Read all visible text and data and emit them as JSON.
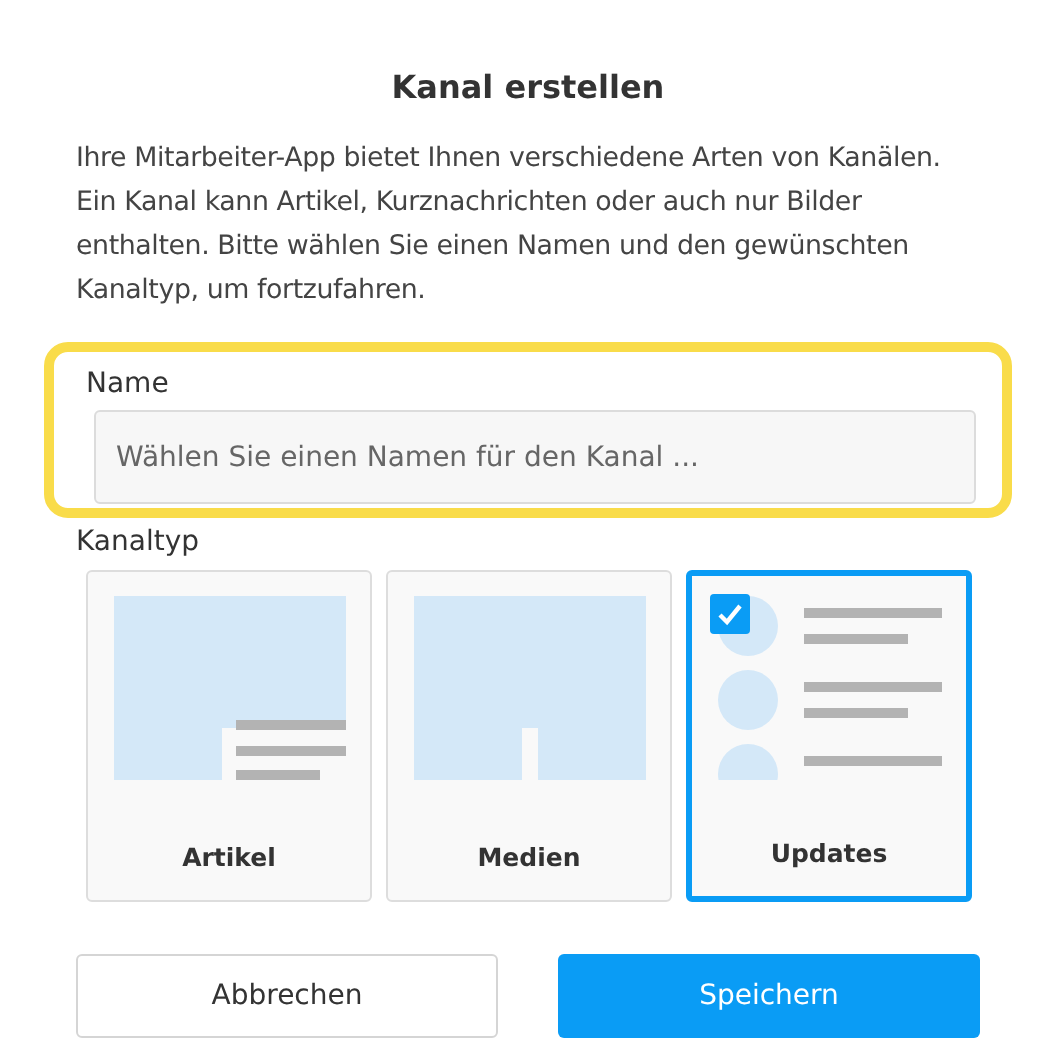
{
  "dialog": {
    "title": "Kanal erstellen",
    "description": "Ihre Mitarbeiter-App bietet Ihnen verschiedene Arten von Kanälen. Ein Kanal kann Artikel, Kurznachrichten oder auch nur Bilder enthalten. Bitte wählen Sie einen Namen und den gewünschten Kanaltyp, um fortzufahren.",
    "name_field": {
      "label": "Name",
      "placeholder": "Wählen Sie einen Namen für den Kanal ...",
      "highlighted": true
    },
    "channel_type": {
      "label": "Kanaltyp",
      "options": [
        {
          "kind": "article",
          "label": "Artikel",
          "selected": false
        },
        {
          "kind": "media",
          "label": "Medien",
          "selected": false
        },
        {
          "kind": "updates",
          "label": "Updates",
          "selected": true
        }
      ]
    },
    "buttons": [
      {
        "label": "Abbrechen",
        "kind": "secondary"
      },
      {
        "label": "Speichern",
        "kind": "primary"
      }
    ]
  }
}
